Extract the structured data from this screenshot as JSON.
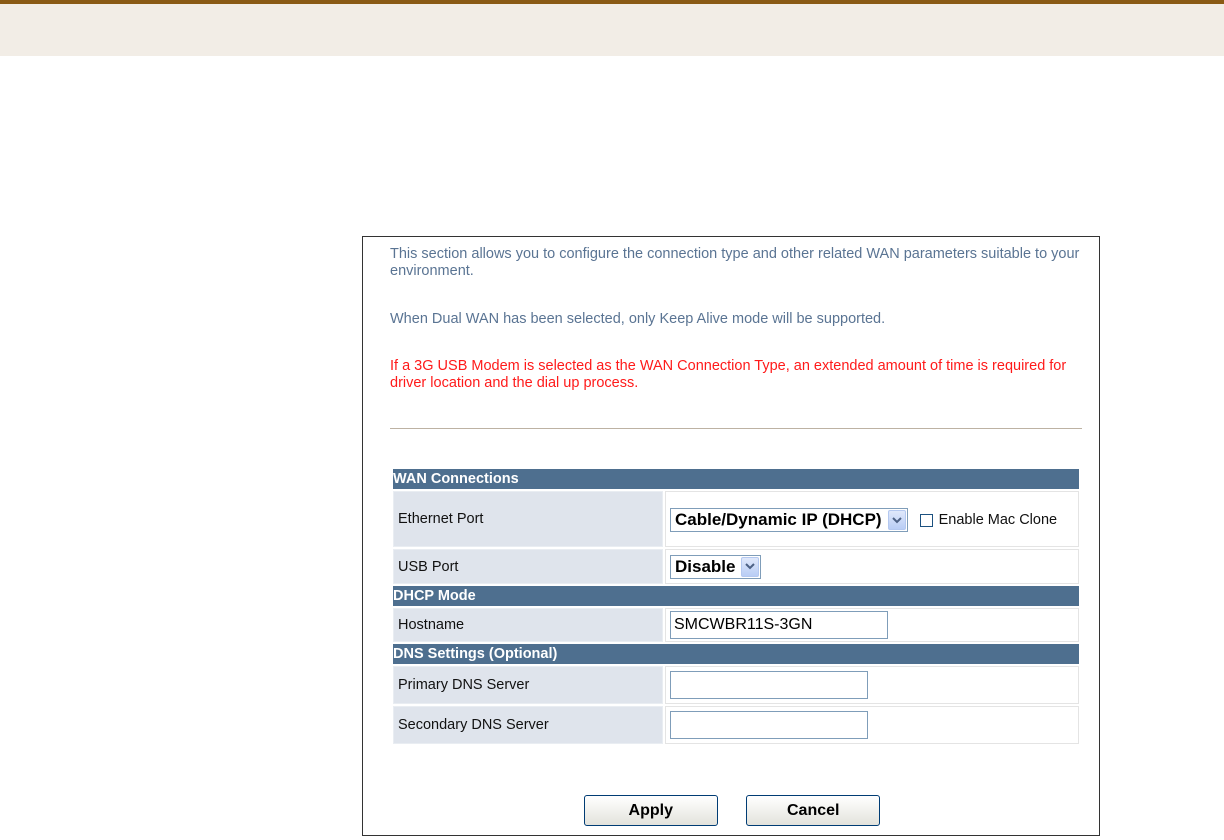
{
  "intro": {
    "line1": "This section allows you to configure the connection type and other related WAN parameters suitable to your environment.",
    "line2": "When Dual WAN has been selected, only Keep Alive mode will be supported.",
    "warning": "If a 3G USB Modem is selected as the WAN Connection Type, an extended amount of time is required for driver location and the dial up process."
  },
  "wan": {
    "heading": "WAN Connections",
    "ethernet_label": "Ethernet Port",
    "ethernet_value": "Cable/Dynamic IP (DHCP)",
    "mac_clone_label": "Enable Mac Clone",
    "usb_label": "USB Port",
    "usb_value": "Disable"
  },
  "dhcp": {
    "heading": "DHCP Mode",
    "hostname_label": "Hostname",
    "hostname_value": "SMCWBR11S-3GN"
  },
  "dns": {
    "heading": "DNS Settings (Optional)",
    "primary_label": "Primary DNS Server",
    "primary_value": "",
    "secondary_label": "Secondary DNS Server",
    "secondary_value": ""
  },
  "buttons": {
    "apply": "Apply",
    "cancel": "Cancel"
  },
  "colors": {
    "header_bar": "#4e6f8f",
    "label_cell": "#dfe4ec",
    "intro_text": "#5a7493",
    "warning_text": "#ff1a1a",
    "top_border": "#8a5a14"
  },
  "icons": {
    "dropdown": "chevron-down-icon",
    "checkbox": "checkbox-icon"
  }
}
